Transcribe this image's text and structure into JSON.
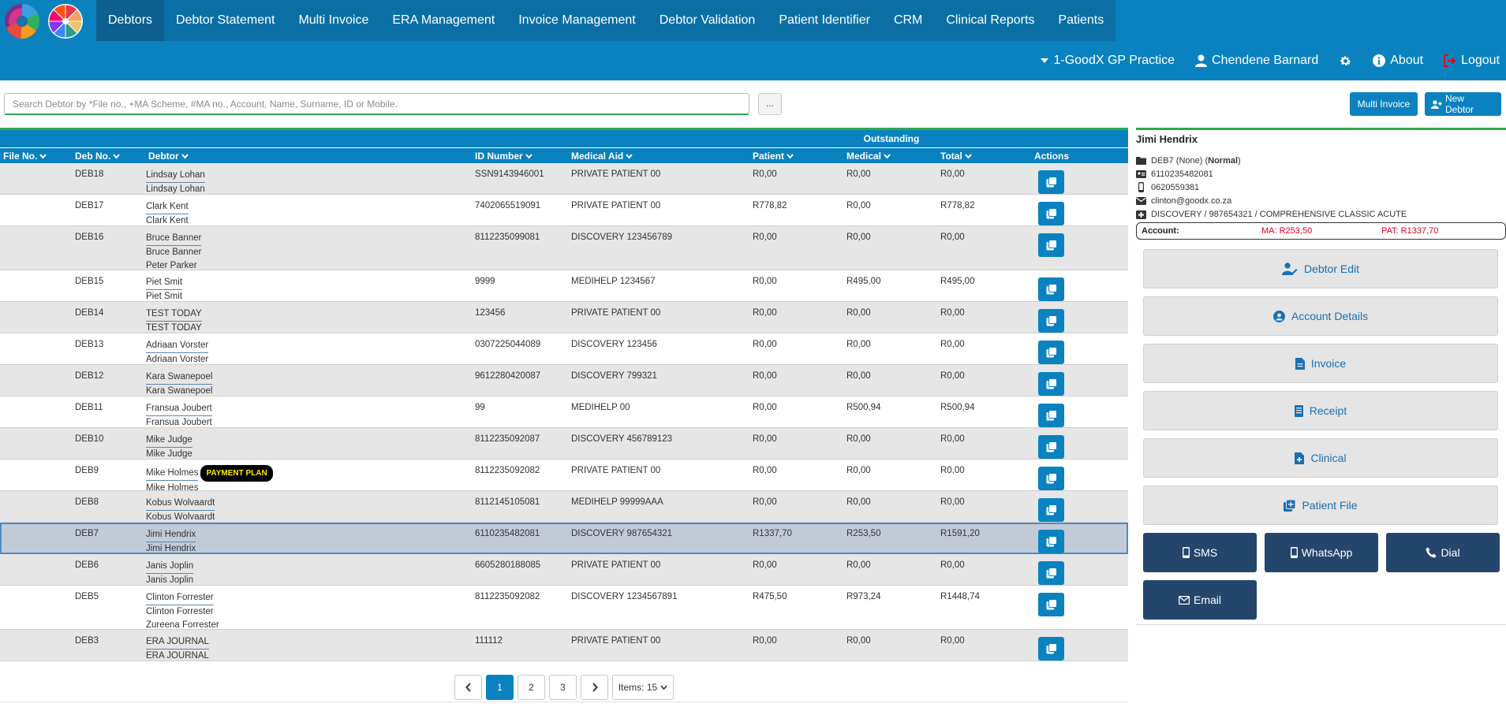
{
  "nav": {
    "items": [
      "Debtors",
      "Debtor Statement",
      "Multi Invoice",
      "ERA Management",
      "Invoice Management",
      "Debtor Validation",
      "Patient Identifier",
      "CRM",
      "Clinical Reports",
      "Patients"
    ],
    "active": 0
  },
  "subnav": {
    "practice": "1-GoodX GP Practice",
    "user": "Chendene Barnard",
    "about": "About",
    "logout": "Logout"
  },
  "search": {
    "placeholder": "Search Debtor by *File no., +MA Scheme, #MA no., Account, Name, Surname, ID or Mobile.",
    "more_label": "..."
  },
  "actions": {
    "multi_invoice": "Multi Invoice",
    "new_debtor": "New Debtor"
  },
  "table": {
    "group_header": "Outstanding",
    "columns": [
      "File No.",
      "Deb No.",
      "Debtor",
      "ID Number",
      "Medical Aid",
      "Patient",
      "Medical",
      "Total",
      "Actions"
    ],
    "rows": [
      {
        "deb": "DEB18",
        "names": [
          "Lindsay Lohan",
          "Lindsay Lohan"
        ],
        "id": "SSN9143946001",
        "aid": "PRIVATE PATIENT 00",
        "patient": "R0,00",
        "medical": "R0,00",
        "total": "R0,00"
      },
      {
        "deb": "DEB17",
        "names": [
          "Clark Kent",
          "Clark Kent"
        ],
        "id": "7402065519091",
        "aid": "PRIVATE PATIENT 00",
        "patient": "R778,82",
        "medical": "R0,00",
        "total": "R778,82"
      },
      {
        "deb": "DEB16",
        "names": [
          "Bruce Banner",
          "Bruce Banner",
          "Peter Parker"
        ],
        "id": "8112235099081",
        "aid": "DISCOVERY 123456789",
        "patient": "R0,00",
        "medical": "R0,00",
        "total": "R0,00"
      },
      {
        "deb": "DEB15",
        "names": [
          "Piet Smit",
          "Piet Smit"
        ],
        "id": "9999",
        "aid": "MEDIHELP 1234567",
        "patient": "R0,00",
        "medical": "R495,00",
        "total": "R495,00"
      },
      {
        "deb": "DEB14",
        "names": [
          "TEST TODAY",
          "TEST TODAY"
        ],
        "id": "123456",
        "aid": "PRIVATE PATIENT 00",
        "patient": "R0,00",
        "medical": "R0,00",
        "total": "R0,00"
      },
      {
        "deb": "DEB13",
        "names": [
          "Adriaan Vorster",
          "Adriaan Vorster"
        ],
        "id": "0307225044089",
        "aid": "DISCOVERY 123456",
        "patient": "R0,00",
        "medical": "R0,00",
        "total": "R0,00"
      },
      {
        "deb": "DEB12",
        "names": [
          "Kara Swanepoel",
          "Kara Swanepoel"
        ],
        "id": "9612280420087",
        "aid": "DISCOVERY 799321",
        "patient": "R0,00",
        "medical": "R0,00",
        "total": "R0,00"
      },
      {
        "deb": "DEB11",
        "names": [
          "Fransua Joubert",
          "Fransua Joubert"
        ],
        "id": "99",
        "aid": "MEDIHELP 00",
        "patient": "R0,00",
        "medical": "R500,94",
        "total": "R500,94"
      },
      {
        "deb": "DEB10",
        "names": [
          "Mike Judge",
          "Mike Judge"
        ],
        "id": "8112235092087",
        "aid": "DISCOVERY 456789123",
        "patient": "R0,00",
        "medical": "R0,00",
        "total": "R0,00"
      },
      {
        "deb": "DEB9",
        "names": [
          "Mike Holmes",
          "Mike Holmes"
        ],
        "badge": "PAYMENT PLAN",
        "id": "8112235092082",
        "aid": "PRIVATE PATIENT 00",
        "patient": "R0,00",
        "medical": "R0,00",
        "total": "R0,00"
      },
      {
        "deb": "DEB8",
        "names": [
          "Kobus Wolvaardt",
          "Kobus Wolvaardt"
        ],
        "id": "8112145105081",
        "aid": "MEDIHELP 99999AAA",
        "patient": "R0,00",
        "medical": "R0,00",
        "total": "R0,00"
      },
      {
        "deb": "DEB7",
        "names": [
          "Jimi Hendrix",
          "Jimi Hendrix"
        ],
        "id": "6110235482081",
        "aid": "DISCOVERY 987654321",
        "patient": "R1337,70",
        "medical": "R253,50",
        "total": "R1591,20",
        "selected": true
      },
      {
        "deb": "DEB6",
        "names": [
          "Janis Joplin",
          "Janis Joplin"
        ],
        "id": "6605280188085",
        "aid": "PRIVATE PATIENT 00",
        "patient": "R0,00",
        "medical": "R0,00",
        "total": "R0,00"
      },
      {
        "deb": "DEB5",
        "names": [
          "Clinton Forrester",
          "Clinton Forrester",
          "Zureena Forrester"
        ],
        "id": "8112235092082",
        "aid": "DISCOVERY 1234567891",
        "patient": "R475,50",
        "medical": "R973,24",
        "total": "R1448,74"
      },
      {
        "deb": "DEB3",
        "names": [
          "ERA JOURNAL",
          "ERA JOURNAL"
        ],
        "id": "111112",
        "aid": "PRIVATE PATIENT 00",
        "patient": "R0,00",
        "medical": "R0,00",
        "total": "R0,00"
      }
    ]
  },
  "pagination": {
    "pages": [
      "1",
      "2",
      "3"
    ],
    "current": 0,
    "items_label": "Items: 15"
  },
  "detail": {
    "name": "Jimi Hendrix",
    "deb_prefix": "DEB7 (None) (",
    "deb_status": "Normal",
    "deb_suffix": ")",
    "id_number": "6110235482081",
    "mobile": "0620559381",
    "email": "clinton@goodx.co.za",
    "medical_aid": "DISCOVERY / 987654321 / COMPREHENSIVE CLASSIC ACUTE",
    "account_label": "Account:",
    "ma_balance": "MA: R253,50",
    "pat_balance": "PAT: R1337,70",
    "buttons": [
      "Debtor Edit",
      "Account Details",
      "Invoice",
      "Receipt",
      "Clinical",
      "Patient File"
    ],
    "contact": [
      "SMS",
      "WhatsApp",
      "Dial",
      "Email"
    ]
  },
  "colors": {
    "primary": "#0a82bf",
    "nav_bg": "#0b6fa6",
    "accent_green": "#2fa84f",
    "dark_button": "#24466d",
    "alert_red": "#e0001b"
  }
}
